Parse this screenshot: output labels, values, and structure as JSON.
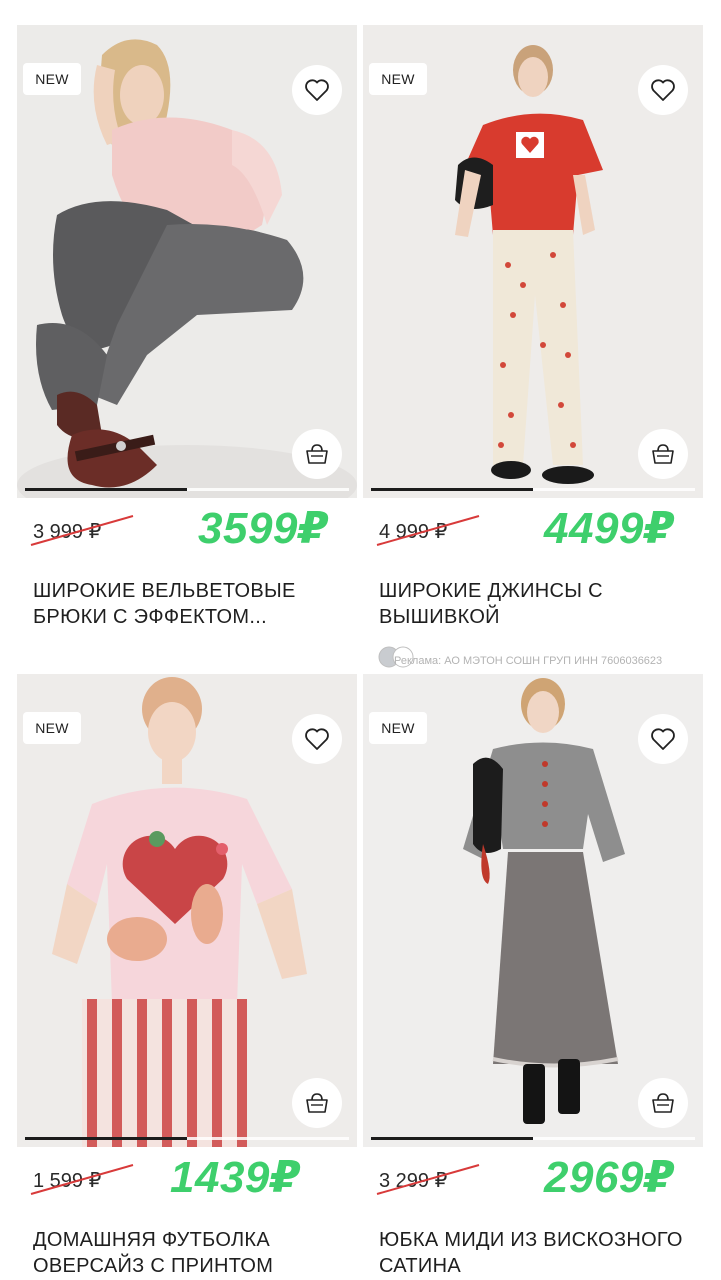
{
  "colors": {
    "new_price": "#3ecf6c",
    "strike_line": "#d83a3a",
    "image_bg": "#efedeb"
  },
  "products": [
    {
      "badge": "NEW",
      "old_price": "3 999 ₽",
      "new_price": "3599₽",
      "title": "ШИРОКИЕ ВЕЛЬВЕТОВЫЕ БРЮКИ С ЭФФЕКТОМ...",
      "image_progress": 0.5,
      "image": "woman-sitting-pink-sweater-grey-trousers"
    },
    {
      "badge": "NEW",
      "old_price": "4 999 ₽",
      "new_price": "4499₽",
      "title": "ШИРОКИЕ ДЖИНСЫ С ВЫШИВКОЙ",
      "image_progress": 0.5,
      "image": "woman-red-tshirt-polka-jeans",
      "color_swatches": [
        "#c9ccd0",
        "#ffffff"
      ]
    },
    {
      "badge": "NEW",
      "old_price": "1 599 ₽",
      "new_price": "1439₽",
      "title": "ДОМАШНЯЯ ФУТБОЛКА ОВЕРСАЙЗ С ПРИНТОМ",
      "image_progress": 0.5,
      "image": "woman-pink-tshirt-heart-print"
    },
    {
      "badge": "NEW",
      "old_price": "3 299 ₽",
      "new_price": "2969₽",
      "title": "ЮБКА МИДИ ИЗ ВИСКОЗНОГО САТИНА",
      "image_progress": 0.5,
      "image": "woman-grey-cardigan-grey-skirt"
    }
  ],
  "ad_note": "Реклама: АО МЭТОН СОШН ГРУП ИНН 7606036623"
}
